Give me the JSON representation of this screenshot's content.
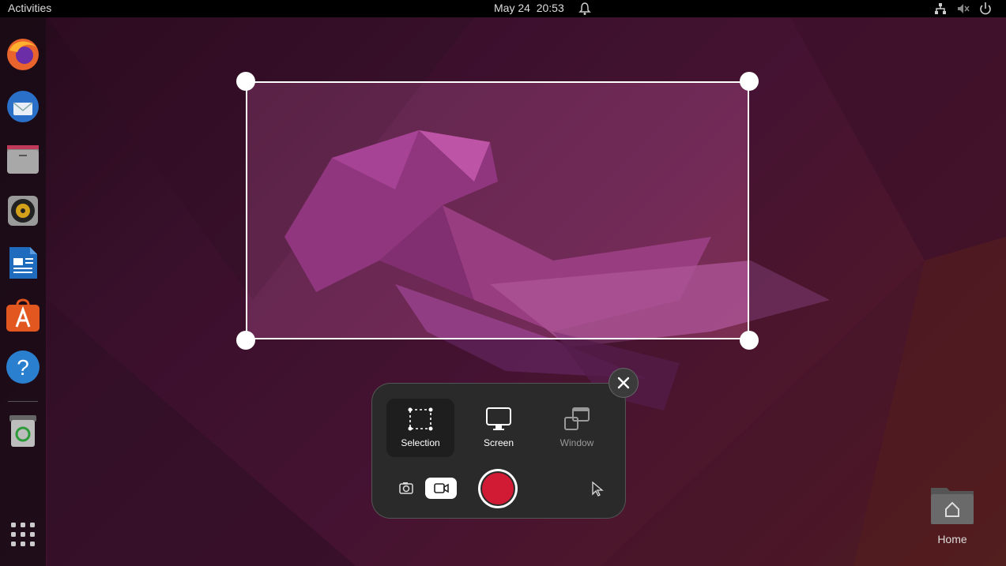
{
  "topbar": {
    "activities": "Activities",
    "date": "May 24",
    "time": "20:53"
  },
  "dock": {
    "items": [
      {
        "icon": "firefox-icon"
      },
      {
        "icon": "thunderbird-icon"
      },
      {
        "icon": "files-icon"
      },
      {
        "icon": "rhythmbox-icon"
      },
      {
        "icon": "writer-icon"
      },
      {
        "icon": "app-center-icon"
      },
      {
        "icon": "help-icon"
      },
      {
        "icon": "trash-icon"
      },
      {
        "icon": "show-apps-icon"
      }
    ]
  },
  "screenshot_tool": {
    "modes": [
      {
        "label": "Selection",
        "active": true
      },
      {
        "label": "Screen",
        "active": false
      },
      {
        "label": "Window",
        "active": false
      }
    ]
  },
  "desktop": {
    "home_label": "Home"
  },
  "colors": {
    "record": "#d11a33",
    "panel": "#2a2a2a"
  }
}
